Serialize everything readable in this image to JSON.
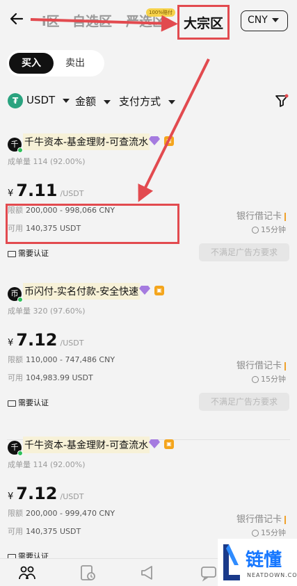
{
  "header": {
    "back_icon": "back-arrow-icon",
    "tabs": [
      {
        "label": "i区",
        "active": false
      },
      {
        "label": "自选区",
        "active": false
      },
      {
        "label": "严选区",
        "active": false,
        "badge": "100%赔付"
      },
      {
        "label": "大宗区",
        "active": true
      }
    ],
    "currency": "CNY"
  },
  "toggle": {
    "buy": "买入",
    "sell": "卖出"
  },
  "filters": {
    "coin": "USDT",
    "coin_icon_letter": "₮",
    "amount": "金额",
    "payment": "支付方式",
    "filter_icon": "funnel-icon"
  },
  "ads": [
    {
      "avatar": "千",
      "merchant": "千牛资本-基金理财-可查流水",
      "stats_label": "成单量",
      "stats": "114 (92.00%)",
      "yen": "¥",
      "price": "7.11",
      "unit": "/USDT",
      "limit_label": "限额",
      "limit": "200,000 - 998,066 CNY",
      "avail_label": "可用",
      "available": "140,375 USDT",
      "payment": "银行借记卡",
      "time": "15分钟",
      "verify": "需要认证",
      "action": "不满足广告方要求"
    },
    {
      "avatar": "币",
      "merchant": "币闪付-实名付款-安全快速",
      "stats_label": "成单量",
      "stats": "320 (97.60%)",
      "yen": "¥",
      "price": "7.12",
      "unit": "/USDT",
      "limit_label": "限额",
      "limit": "110,000 - 747,486 CNY",
      "avail_label": "可用",
      "available": "104,983.99 USDT",
      "payment": "银行借记卡",
      "time": "15分钟",
      "verify": "需要认证",
      "action": "不满足广告方要求"
    },
    {
      "avatar": "千",
      "merchant": "千牛资本-基金理财-可查流水",
      "stats_label": "成单量",
      "stats": "114 (92.00%)",
      "yen": "¥",
      "price": "7.12",
      "unit": "/USDT",
      "limit_label": "限额",
      "limit": "200,000 - 999,470 CNY",
      "avail_label": "可用",
      "available": "140,375 USDT",
      "payment": "银行借记卡",
      "time": "15分钟",
      "verify": "需要认证",
      "action": ""
    }
  ],
  "bottom_nav": [
    "p2p-icon",
    "orders-icon",
    "ads-icon",
    "chat-icon"
  ],
  "watermark": {
    "text": "链懂",
    "sub": "NEATDOWN.COM"
  },
  "colors": {
    "annotation_red": "#e24a4f",
    "accent_green": "#2aa37f",
    "watermark_blue": "#1677ff"
  }
}
